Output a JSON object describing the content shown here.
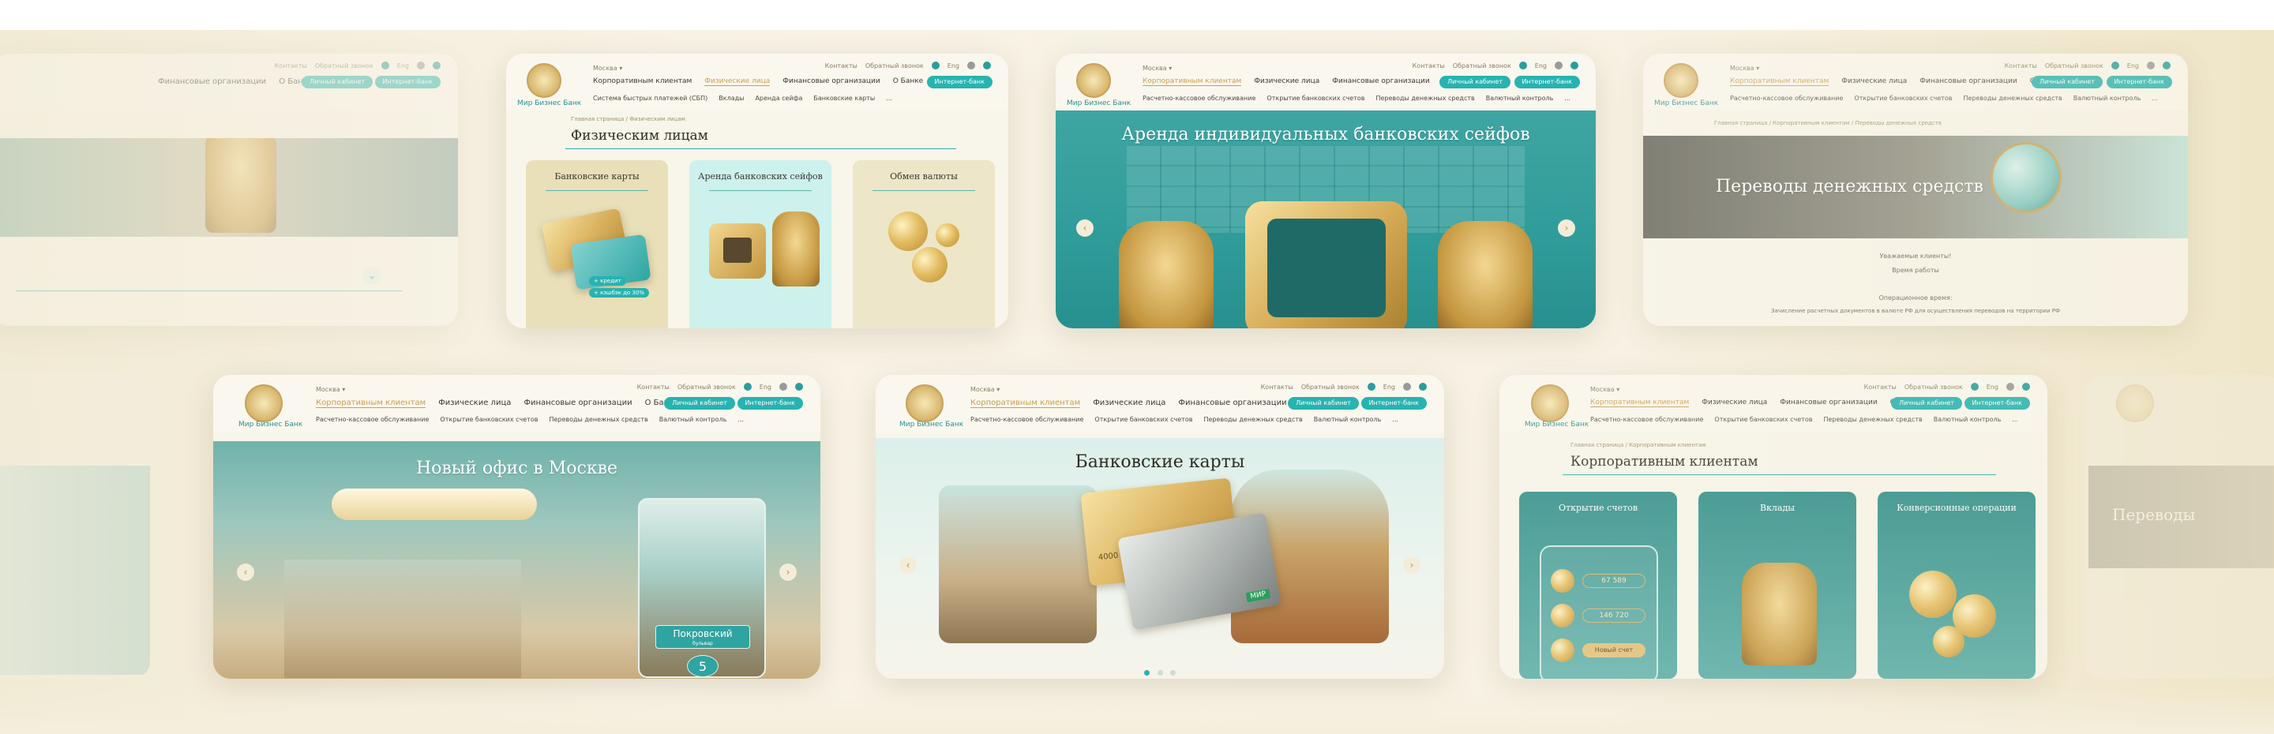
{
  "brand": {
    "bank_name": "Мир Бизнес Банк",
    "city": "Москва ▾",
    "colors": {
      "teal": "#27b3b0",
      "gold": "#c9a04f",
      "cream": "#f8f5ea"
    }
  },
  "util": {
    "contacts": "Контакты",
    "callback": "Обратный звонок",
    "lang": "Eng"
  },
  "nav": {
    "corporate": "Корпоративным клиентам",
    "individuals": "Физические лица",
    "financial": "Финансовые организации",
    "about": "О Банке"
  },
  "buttons": {
    "personal": "Личный кабинет",
    "internet": "Интернет-банк"
  },
  "subnav_corp": [
    "Расчетно-кассовое обслуживание",
    "Открытие банковских счетов",
    "Переводы денежных средств",
    "Валютный контроль",
    "..."
  ],
  "subnav_ind": [
    "Система быстрых платежей (СБП)",
    "Вклады",
    "Аренда сейфа",
    "Банковские карты",
    "..."
  ],
  "card_individuals": {
    "breadcrumb": "Главная страница / Физическим лицам",
    "title": "Физическим лицам",
    "tiles": [
      {
        "label": "Банковские карты"
      },
      {
        "label": "Аренда банковских сейфов"
      },
      {
        "label": "Обмен валюты"
      }
    ],
    "promo_line1": "+ кредит",
    "promo_line2": "+ кэшбэк до 30%"
  },
  "card_safes": {
    "title": "Аренда индивидуальных банковских сейфов"
  },
  "card_transfers": {
    "breadcrumb": "Главная страница / Корпоративным клиентам / Переводы денежных средств",
    "title": "Переводы денежных средств",
    "info1": "Уважаемые клиенты!",
    "info2": "Время работы",
    "info3": "Операционное время:",
    "info4": "Зачисление расчетных документов в валюте РФ для осуществления переводов на территории РФ"
  },
  "card_office": {
    "title": "Новый офис в Москве",
    "sign": "Покровский",
    "sign_sub": "бульвар",
    "number": "5"
  },
  "card_cards": {
    "title": "Банковские карты",
    "card_number": "4000 1234 5678 9010",
    "card_brand": "МИР",
    "pagination": 3
  },
  "card_corporate": {
    "breadcrumb": "Главная страница / Корпоративным клиентам",
    "title": "Корпоративным клиентам",
    "tiles": [
      {
        "label": "Открытие счетов"
      },
      {
        "label": "Вклады"
      },
      {
        "label": "Конверсионные операции"
      }
    ],
    "balance1": "67 589",
    "balance2": "146 720",
    "new_account": "Новый счет"
  },
  "card_leftfaded": {
    "note": "Физические лица"
  },
  "card_rightfaded": {
    "title": "Переводы"
  }
}
